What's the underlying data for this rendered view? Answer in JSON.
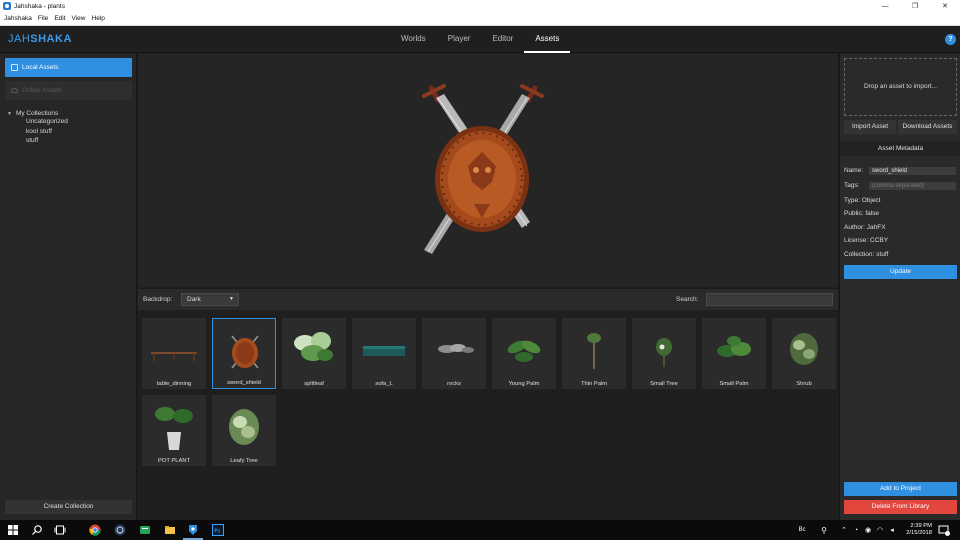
{
  "window": {
    "title": "Jahshaka - plants",
    "controls": [
      "—",
      "❐",
      "✕"
    ]
  },
  "menu": [
    "Jahshaka",
    "File",
    "Edit",
    "View",
    "Help"
  ],
  "header": {
    "logo_a": "JAH",
    "logo_b": "SHAKA",
    "tabs": [
      "Worlds",
      "Player",
      "Editor",
      "Assets"
    ],
    "active_tab": "Assets",
    "help": "?"
  },
  "sidebar": {
    "local_assets": "Local Assets",
    "online_assets": "Online Assets",
    "collections_root": "My Collections",
    "collections": [
      "Uncategorized",
      "kool stuff",
      "stuff"
    ],
    "create_collection": "Create Collection"
  },
  "toolbar": {
    "backdrop_label": "Backdrop:",
    "backdrop_value": "Dark",
    "search_label": "Search:",
    "search_value": ""
  },
  "assets": [
    {
      "name": "table_dinning",
      "icon": "table-thumb"
    },
    {
      "name": "sword_shield",
      "icon": "shield-thumb",
      "selected": true
    },
    {
      "name": "splitleaf",
      "icon": "plant-thumb"
    },
    {
      "name": "sofa_L",
      "icon": "sofa-thumb"
    },
    {
      "name": "rocks",
      "icon": "rocks-thumb"
    },
    {
      "name": "Young Palm",
      "icon": "plant-thumb"
    },
    {
      "name": "Thin Palm",
      "icon": "tree-thumb"
    },
    {
      "name": "Small Tree",
      "icon": "tree-thumb"
    },
    {
      "name": "Small Palm",
      "icon": "plant-thumb"
    },
    {
      "name": "Shrub",
      "icon": "shrub-thumb"
    },
    {
      "name": "POT PLANT",
      "icon": "pot-plant-thumb"
    },
    {
      "name": "Leafy Tree",
      "icon": "shrub-thumb"
    }
  ],
  "right_panel": {
    "dropzone": "Drop an asset to import...",
    "import_btn": "Import Asset",
    "download_btn": "Download Assets",
    "metadata_header": "Asset Metadata",
    "name_label": "Name:",
    "name_value": "sword_shield",
    "tags_label": "Tags:",
    "tags_placeholder": "(comma separated)",
    "type": "Type: Object",
    "public": "Public: false",
    "author": "Author: JahFX",
    "license": "License: CCBY",
    "collection": "Collection: stuff",
    "update_btn": "Update",
    "add_btn": "Add to Project",
    "delete_btn": "Delete From Library"
  },
  "taskbar": {
    "time": "2:39 PM",
    "date": "2/15/2018",
    "lang": "Bc",
    "notifications": "2"
  },
  "colors": {
    "accent": "#2f8fe0",
    "danger": "#e2463c"
  }
}
